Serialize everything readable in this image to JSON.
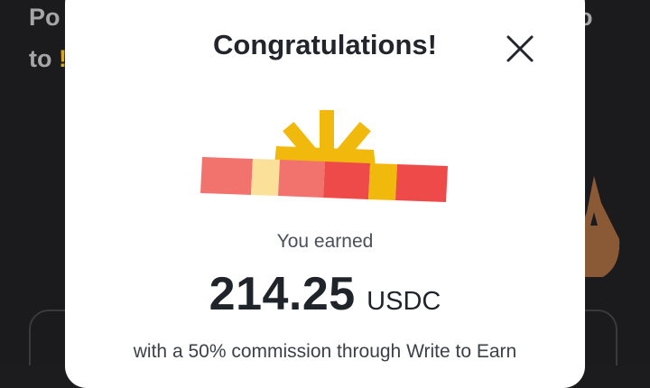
{
  "background": {
    "line1": "Po",
    "line2_prefix": "to",
    "line2_accent": "!",
    "right_text": "o"
  },
  "modal": {
    "title": "Congratulations!",
    "earned_label": "You earned",
    "amount": "214.25",
    "currency": "USDC",
    "commission_text": "with a 50% commission through Write to Earn"
  },
  "icons": {
    "close": "close-icon",
    "gift": "gift-icon"
  },
  "colors": {
    "modal_bg": "#ffffff",
    "title": "#22252b",
    "gift_coral": "#f2726d",
    "gift_red": "#ef4a4a",
    "gift_cream": "#fbe09a",
    "gift_gold": "#f0b90b"
  }
}
